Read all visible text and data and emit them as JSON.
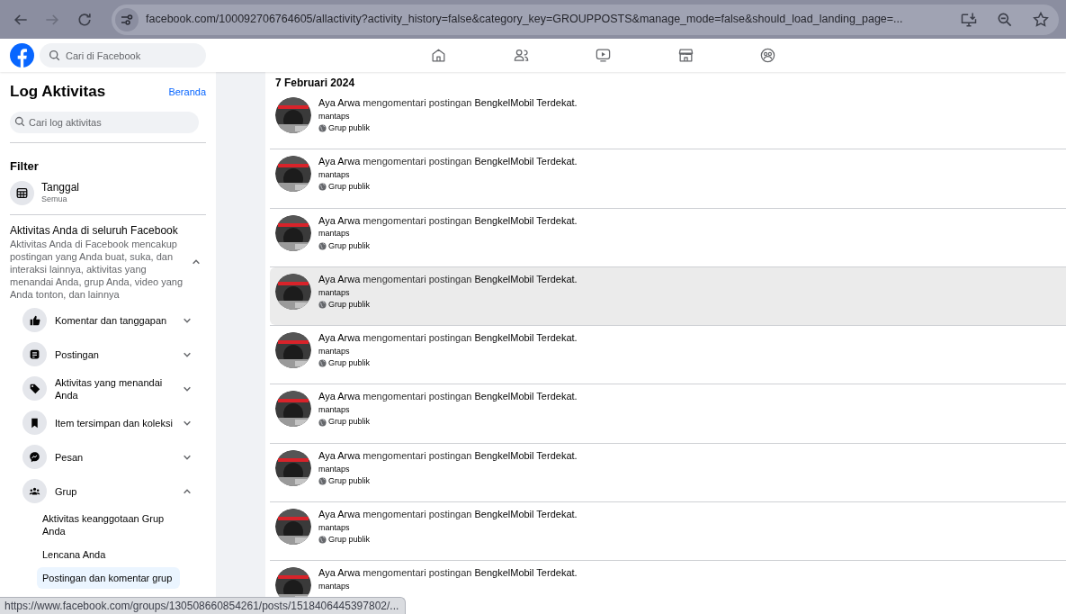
{
  "browser": {
    "url": "facebook.com/100092706764605/allactivity?activity_history=false&category_key=GROUPPOSTS&manage_mode=false&should_load_landing_page=...",
    "forward_disabled": true
  },
  "topbar": {
    "search": {
      "placeholder": "Cari di Facebook"
    }
  },
  "sidebar": {
    "title": "Log Aktivitas",
    "home_link": "Beranda",
    "search": {
      "placeholder": "Cari log aktivitas"
    },
    "filter_title": "Filter",
    "date_filter": {
      "label": "Tanggal",
      "value": "Semua"
    },
    "section": {
      "title": "Aktivitas Anda di seluruh Facebook",
      "description": "Aktivitas Anda di Facebook mencakup postingan yang Anda buat, suka, dan interaksi lainnya, aktivitas yang menandai Anda, grup Anda, video yang Anda tonton, dan lainnya",
      "expanded": true
    },
    "items": [
      {
        "label": "Komentar dan tanggapan",
        "expanded": false
      },
      {
        "label": "Postingan",
        "expanded": false
      },
      {
        "label": "Aktivitas yang menandai Anda",
        "expanded": false
      },
      {
        "label": "Item tersimpan dan koleksi",
        "expanded": false
      },
      {
        "label": "Pesan",
        "expanded": false
      },
      {
        "label": "Grup",
        "expanded": true,
        "children": [
          {
            "label": "Aktivitas keanggotaan Grup Anda",
            "selected": false
          },
          {
            "label": "Lencana Anda",
            "selected": false
          },
          {
            "label": "Postingan dan komentar grup",
            "selected": true
          }
        ]
      }
    ]
  },
  "feed": {
    "date": "7 Februari 2024",
    "rows": [
      {
        "actor": "Aya Arwa",
        "action": "mengomentari postingan",
        "target": "BengkelMobil Terdekat.",
        "comment": "mantaps",
        "audience": "Grup publik",
        "hovered": false
      },
      {
        "actor": "Aya Arwa",
        "action": "mengomentari postingan",
        "target": "BengkelMobil Terdekat.",
        "comment": "mantaps",
        "audience": "Grup publik",
        "hovered": false
      },
      {
        "actor": "Aya Arwa",
        "action": "mengomentari postingan",
        "target": "BengkelMobil Terdekat.",
        "comment": "mantaps",
        "audience": "Grup publik",
        "hovered": false
      },
      {
        "actor": "Aya Arwa",
        "action": "mengomentari postingan",
        "target": "BengkelMobil Terdekat.",
        "comment": "mantaps",
        "audience": "Grup publik",
        "hovered": true
      },
      {
        "actor": "Aya Arwa",
        "action": "mengomentari postingan",
        "target": "BengkelMobil Terdekat.",
        "comment": "mantaps",
        "audience": "Grup publik",
        "hovered": false
      },
      {
        "actor": "Aya Arwa",
        "action": "mengomentari postingan",
        "target": "BengkelMobil Terdekat.",
        "comment": "mantaps",
        "audience": "Grup publik",
        "hovered": false
      },
      {
        "actor": "Aya Arwa",
        "action": "mengomentari postingan",
        "target": "BengkelMobil Terdekat.",
        "comment": "mantaps",
        "audience": "Grup publik",
        "hovered": false
      },
      {
        "actor": "Aya Arwa",
        "action": "mengomentari postingan",
        "target": "BengkelMobil Terdekat.",
        "comment": "mantaps",
        "audience": "Grup publik",
        "hovered": false
      },
      {
        "actor": "Aya Arwa",
        "action": "mengomentari postingan",
        "target": "BengkelMobil Terdekat.",
        "comment": "mantaps",
        "hovered": false
      }
    ]
  },
  "status_bar": {
    "text": "https://www.facebook.com/groups/130508660854261/posts/1518406445397802/..."
  }
}
